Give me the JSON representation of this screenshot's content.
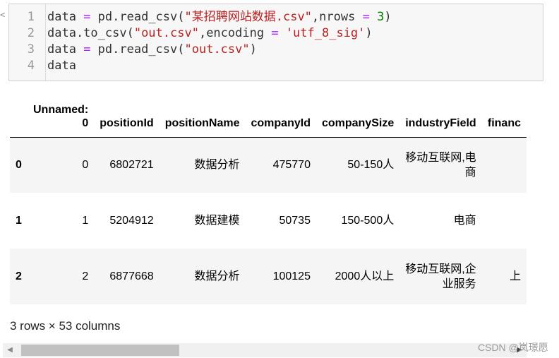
{
  "code_cell": {
    "prompt_marker": "<",
    "lines": [
      {
        "num": "1",
        "parts": [
          {
            "t": "data ",
            "c": ""
          },
          {
            "t": "=",
            "c": "tok-op"
          },
          {
            "t": " pd.read_csv(",
            "c": ""
          },
          {
            "t": "\"某招聘网站数据.csv\"",
            "c": "tok-str"
          },
          {
            "t": ",nrows ",
            "c": ""
          },
          {
            "t": "=",
            "c": "tok-op"
          },
          {
            "t": " ",
            "c": ""
          },
          {
            "t": "3",
            "c": "tok-num"
          },
          {
            "t": ")",
            "c": ""
          }
        ]
      },
      {
        "num": "2",
        "parts": [
          {
            "t": "data.to_csv(",
            "c": ""
          },
          {
            "t": "\"out.csv\"",
            "c": "tok-str"
          },
          {
            "t": ",encoding ",
            "c": ""
          },
          {
            "t": "=",
            "c": "tok-op"
          },
          {
            "t": " ",
            "c": ""
          },
          {
            "t": "'utf_8_sig'",
            "c": "tok-str"
          },
          {
            "t": ")",
            "c": ""
          }
        ]
      },
      {
        "num": "3",
        "parts": [
          {
            "t": "data ",
            "c": ""
          },
          {
            "t": "=",
            "c": "tok-op"
          },
          {
            "t": " pd.read_csv(",
            "c": ""
          },
          {
            "t": "\"out.csv\"",
            "c": "tok-str"
          },
          {
            "t": ")",
            "c": ""
          }
        ]
      },
      {
        "num": "4",
        "parts": [
          {
            "t": "data",
            "c": ""
          }
        ]
      }
    ]
  },
  "output_table": {
    "columns": [
      "",
      "Unnamed:\n0",
      "positionId",
      "positionName",
      "companyId",
      "companySize",
      "industryField",
      "financ"
    ],
    "rows": [
      {
        "index": "0",
        "cells": [
          "0",
          "6802721",
          "数据分析",
          "475770",
          "50-150人",
          "移动互联网,电\n商",
          ""
        ]
      },
      {
        "index": "1",
        "cells": [
          "1",
          "5204912",
          "数据建模",
          "50735",
          "150-500人",
          "电商",
          ""
        ]
      },
      {
        "index": "2",
        "cells": [
          "2",
          "6877668",
          "数据分析",
          "100125",
          "2000人以上",
          "移动互联网,企\n业服务",
          "上"
        ]
      }
    ]
  },
  "summary": "3 rows × 53 columns",
  "scrollbar": {
    "left_arrow": "◀",
    "right_arrow": "▶",
    "thumb_fraction": 0.3
  },
  "watermark": "CSDN @岚璟愿"
}
